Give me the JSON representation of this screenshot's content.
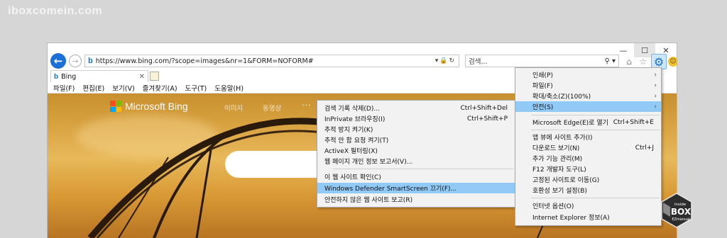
{
  "watermark": "iboxcomein.com",
  "browser": {
    "url": "https://www.bing.com/?scope=images&nr=1&FORM=NOFORM#",
    "search_placeholder": "검색...",
    "tab_title": "Bing"
  },
  "menubar": [
    "파일(F)",
    "편집(E)",
    "보기(V)",
    "즐겨찾기(A)",
    "도구(T)",
    "도움말(H)"
  ],
  "page": {
    "logo_text": "Microsoft Bing",
    "nav": [
      "이미지",
      "동영상"
    ],
    "more": "···",
    "logo_colors": [
      "#f25022",
      "#7fba00",
      "#00a4ef",
      "#ffb900"
    ]
  },
  "tools_menu": [
    {
      "label": "인쇄(P)",
      "arrow": "›"
    },
    {
      "label": "파일(F)",
      "arrow": "›"
    },
    {
      "label": "확대/축소(Z)(100%)",
      "arrow": "›"
    },
    {
      "label": "안전(S)",
      "arrow": "›"
    },
    {
      "label": "Microsoft Edge(E)로 열기",
      "shortcut": "Ctrl+Shift+E"
    },
    {
      "label": "앱 뷰에 사이트 추가(I)"
    },
    {
      "label": "다운로드 보기(N)",
      "shortcut": "Ctrl+J"
    },
    {
      "label": "추가 기능 관리(M)"
    },
    {
      "label": "F12 개발자 도구(L)"
    },
    {
      "label": "고정된 사이트로 이동(G)"
    },
    {
      "label": "호환성 보기 설정(B)"
    },
    {
      "label": "인터넷 옵션(O)"
    },
    {
      "label": "Internet Explorer 정보(A)"
    }
  ],
  "safety_menu": [
    {
      "label": "검색 기록 삭제(D)...",
      "shortcut": "Ctrl+Shift+Del"
    },
    {
      "label": "InPrivate 브라우징(I)",
      "shortcut": "Ctrl+Shift+P"
    },
    {
      "label": "추적 방지 켜기(K)"
    },
    {
      "label": "추적 안 함 요청 켜기(T)"
    },
    {
      "label": "ActiveX 필터링(X)"
    },
    {
      "label": "웹 페이지 개인 정보 보고서(V)..."
    },
    {
      "label": "이 웹 사이트 확인(C)"
    },
    {
      "label": "Windows Defender SmartScreen 끄기(F)..."
    },
    {
      "label": "안전하지 않은 웹 사이트 보고(R)"
    }
  ],
  "badge": {
    "line1": "inside",
    "line2": "BOX",
    "line3": "EZmanual"
  },
  "colors": {
    "accent": "#1c6fd6",
    "highlight": "#91c9f7"
  }
}
